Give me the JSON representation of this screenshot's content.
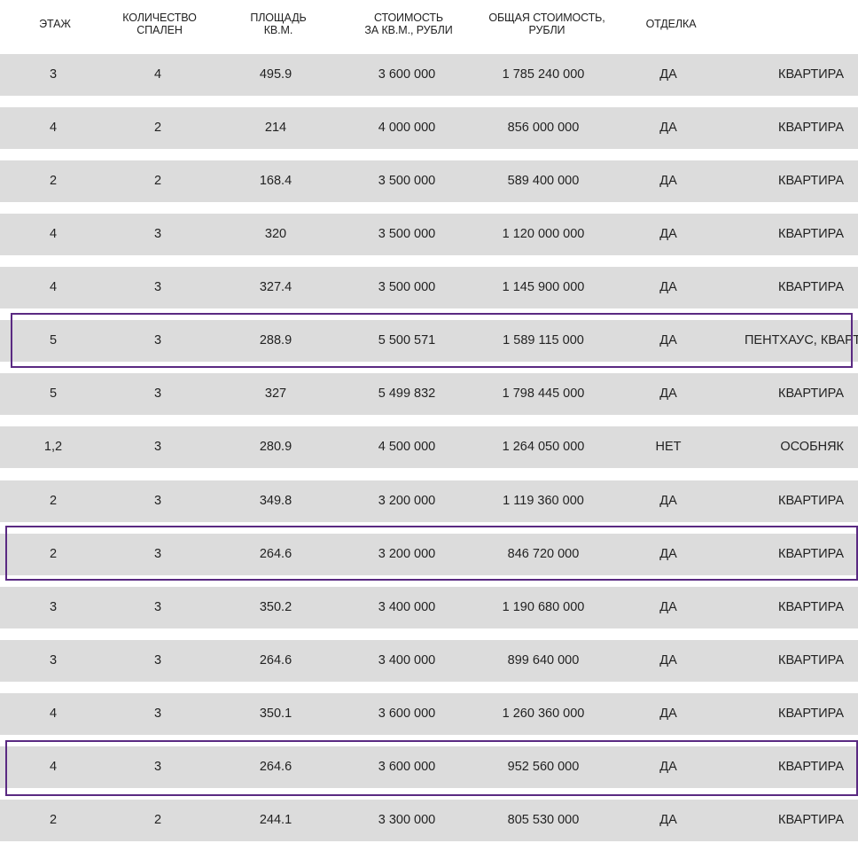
{
  "table": {
    "headers": {
      "floor": [
        "ЭТАЖ"
      ],
      "bedrooms": [
        "КОЛИЧЕСТВО",
        "СПАЛЕН"
      ],
      "area": [
        "ПЛОЩАДЬ",
        "КВ.М."
      ],
      "price_sqm": [
        "СТОИМОСТЬ",
        "ЗА КВ.М., РУБЛИ"
      ],
      "total_price": [
        "ОБЩАЯ СТОИМОСТЬ,",
        "РУБЛИ"
      ],
      "finish": [
        "ОТДЕЛКА"
      ]
    },
    "rows": [
      {
        "floor": "3",
        "bedrooms": "4",
        "area": "495.9",
        "price_sqm": "3 600 000",
        "total": "1 785 240 000",
        "finish": "ДА",
        "type": "КВАРТИРА",
        "highlighted": false
      },
      {
        "floor": "4",
        "bedrooms": "2",
        "area": "214",
        "price_sqm": "4 000 000",
        "total": "856 000 000",
        "finish": "ДА",
        "type": "КВАРТИРА",
        "highlighted": false
      },
      {
        "floor": "2",
        "bedrooms": "2",
        "area": "168.4",
        "price_sqm": "3 500 000",
        "total": "589 400 000",
        "finish": "ДА",
        "type": "КВАРТИРА",
        "highlighted": false
      },
      {
        "floor": "4",
        "bedrooms": "3",
        "area": "320",
        "price_sqm": "3 500 000",
        "total": "1 120 000 000",
        "finish": "ДА",
        "type": "КВАРТИРА",
        "highlighted": false
      },
      {
        "floor": "4",
        "bedrooms": "3",
        "area": "327.4",
        "price_sqm": "3 500 000",
        "total": "1 145 900 000",
        "finish": "ДА",
        "type": "КВАРТИРА",
        "highlighted": false
      },
      {
        "floor": "5",
        "bedrooms": "3",
        "area": "288.9",
        "price_sqm": "5 500 571",
        "total": "1 589 115 000",
        "finish": "ДА",
        "type": "ПЕНТХАУС, КВАРТИРА",
        "highlighted": true
      },
      {
        "floor": "5",
        "bedrooms": "3",
        "area": "327",
        "price_sqm": "5 499 832",
        "total": "1 798 445 000",
        "finish": "ДА",
        "type": "КВАРТИРА",
        "highlighted": false
      },
      {
        "floor": "1,2",
        "bedrooms": "3",
        "area": "280.9",
        "price_sqm": "4 500 000",
        "total": "1 264 050 000",
        "finish": "НЕТ",
        "type": "ОСОБНЯК",
        "highlighted": false
      },
      {
        "floor": "2",
        "bedrooms": "3",
        "area": "349.8",
        "price_sqm": "3 200 000",
        "total": "1 119 360 000",
        "finish": "ДА",
        "type": "КВАРТИРА",
        "highlighted": false
      },
      {
        "floor": "2",
        "bedrooms": "3",
        "area": "264.6",
        "price_sqm": "3 200 000",
        "total": "846 720 000",
        "finish": "ДА",
        "type": "КВАРТИРА",
        "highlighted": true
      },
      {
        "floor": "3",
        "bedrooms": "3",
        "area": "350.2",
        "price_sqm": "3 400 000",
        "total": "1 190 680 000",
        "finish": "ДА",
        "type": "КВАРТИРА",
        "highlighted": false
      },
      {
        "floor": "3",
        "bedrooms": "3",
        "area": "264.6",
        "price_sqm": "3 400 000",
        "total": "899 640 000",
        "finish": "ДА",
        "type": "КВАРТИРА",
        "highlighted": false
      },
      {
        "floor": "4",
        "bedrooms": "3",
        "area": "350.1",
        "price_sqm": "3 600 000",
        "total": "1 260 360 000",
        "finish": "ДА",
        "type": "КВАРТИРА",
        "highlighted": false
      },
      {
        "floor": "4",
        "bedrooms": "3",
        "area": "264.6",
        "price_sqm": "3 600 000",
        "total": "952 560 000",
        "finish": "ДА",
        "type": "КВАРТИРА",
        "highlighted": true
      },
      {
        "floor": "2",
        "bedrooms": "2",
        "area": "244.1",
        "price_sqm": "3 300 000",
        "total": "805 530 000",
        "finish": "ДА",
        "type": "КВАРТИРА",
        "highlighted": false
      }
    ]
  },
  "colors": {
    "row_background": "#dcdcdc",
    "highlight_border": "#5a2a82",
    "text": "#222222"
  }
}
